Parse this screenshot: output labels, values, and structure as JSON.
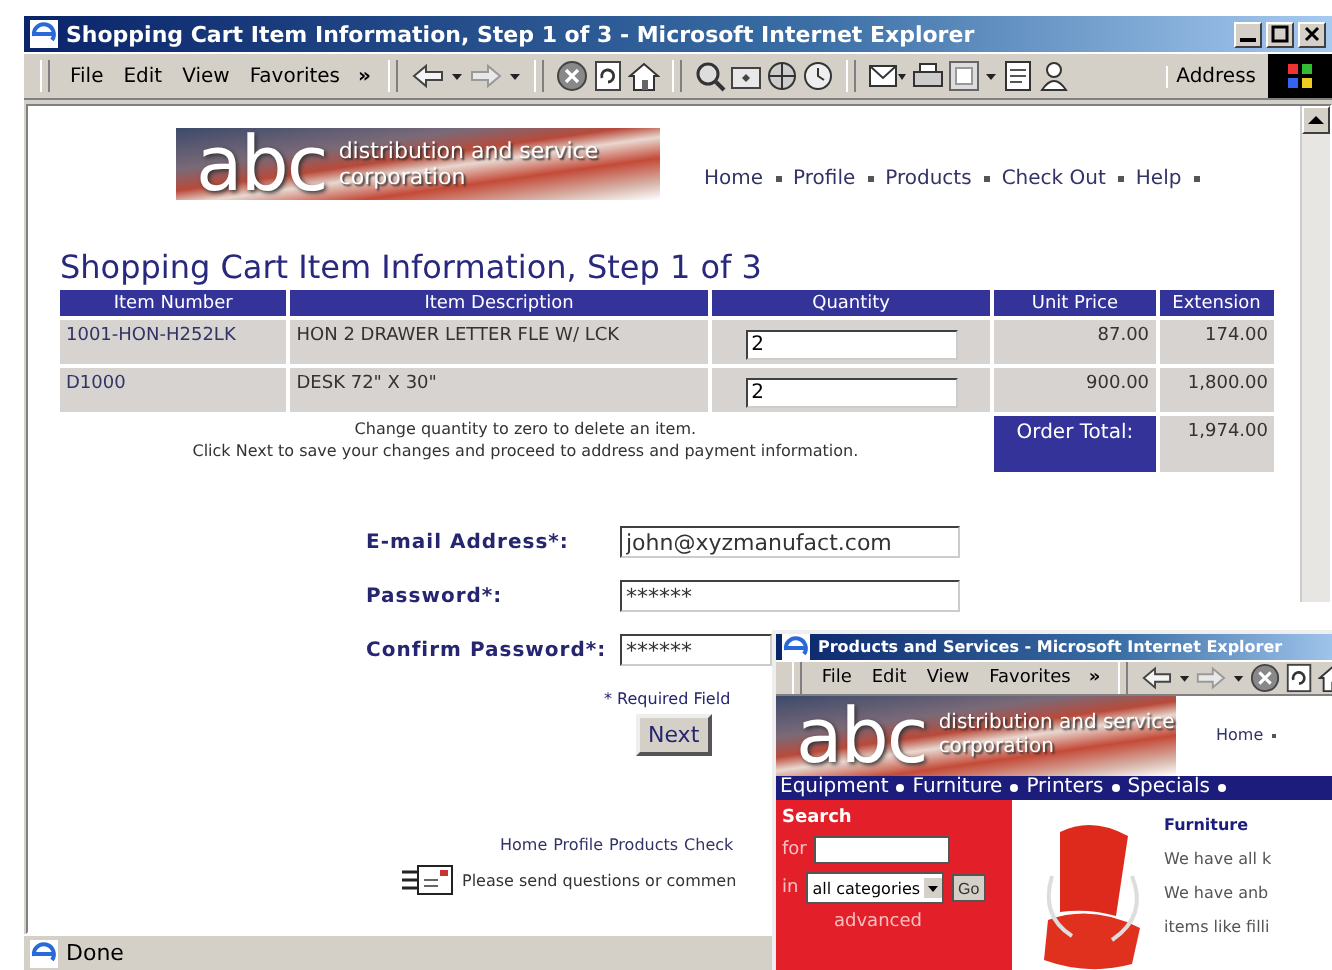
{
  "main_window": {
    "title": "Shopping Cart Item Information, Step 1 of 3 - Microsoft Internet Explorer",
    "menu": [
      "File",
      "Edit",
      "View",
      "Favorites"
    ],
    "more": "»",
    "address_label": "Address",
    "logo": {
      "letters": "abc",
      "line1": "distribution and service",
      "line2": "corporation"
    },
    "nav_links": [
      "Home",
      "Profile",
      "Products",
      "Check Out",
      "Help"
    ],
    "heading": "Shopping Cart Item Information, Step 1 of 3",
    "table": {
      "columns": [
        "Item Number",
        "Item Description",
        "Quantity",
        "Unit Price",
        "Extension"
      ],
      "rows": [
        {
          "item_number": "1001-HON-H252LK",
          "description": "HON 2 DRAWER LETTER FLE W/ LCK",
          "quantity": "2",
          "unit_price": "87.00",
          "extension": "174.00"
        },
        {
          "item_number": "D1000",
          "description": "DESK 72\" X 30\"",
          "quantity": "2",
          "unit_price": "900.00",
          "extension": "1,800.00"
        }
      ],
      "notes": [
        "Change quantity to zero to delete an item.",
        "Click Next to save your changes and proceed to address and payment information."
      ],
      "total_label": "Order Total:",
      "total_value": "1,974.00"
    },
    "form": {
      "fields": [
        {
          "label": "E-mail Address*:",
          "value": "john@xyzmanufact.com"
        },
        {
          "label": "Password*:",
          "value": "******"
        },
        {
          "label": "Confirm Password*:",
          "value": "******"
        }
      ],
      "required_note": "* Required Field",
      "next_button": "Next"
    },
    "footer_links": [
      "Home",
      "Profile",
      "Products",
      "Check"
    ],
    "footer_note": "Please send questions or commen",
    "status": "Done"
  },
  "popup_window": {
    "title": "Products and Services - Microsoft Internet Explorer",
    "menu": [
      "File",
      "Edit",
      "View",
      "Favorites"
    ],
    "more": "»",
    "logo": {
      "letters": "abc",
      "line1": "distribution and service",
      "line2": "corporation"
    },
    "nav_link": "Home",
    "categories": [
      "Equipment",
      "Furniture",
      "Printers",
      "Specials"
    ],
    "search": {
      "title": "Search",
      "for_label": "for",
      "in_label": "in",
      "category": "all categories",
      "go_button": "Go",
      "advanced_link": "advanced"
    },
    "product": {
      "title": "Furniture",
      "lines": [
        "We have all k",
        "We have anb",
        "items like filli"
      ]
    }
  }
}
